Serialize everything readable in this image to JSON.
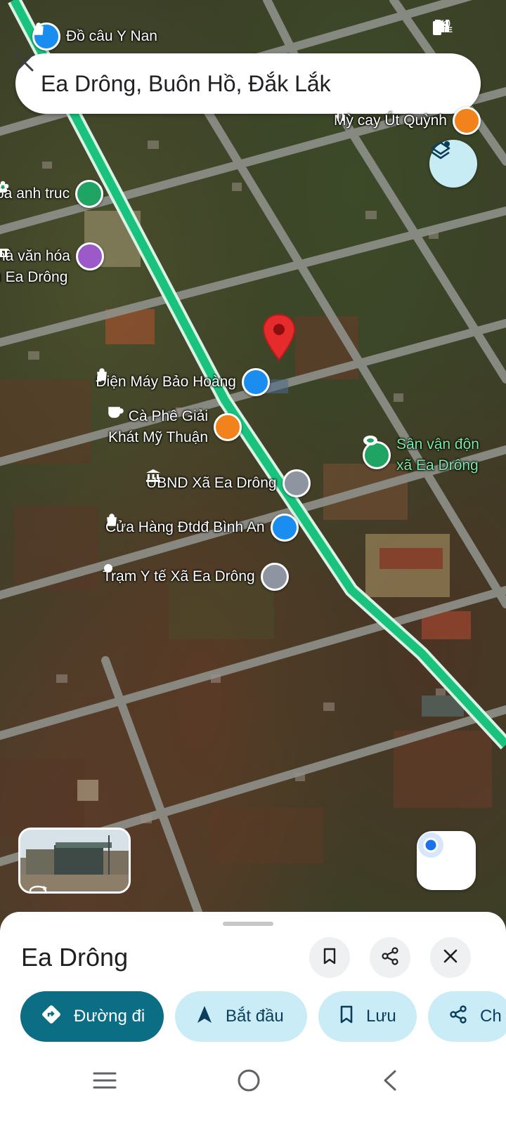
{
  "search": {
    "query": "Ea Drông, Buôn Hồ, Đắk Lắk"
  },
  "pois": {
    "do_cau": "Đồ câu Y Nan",
    "my_cay": "Mỳ cay Út Quỳnh",
    "anh_truc": "pa anh truc",
    "nha_van_hoa_1": "hà văn hóa",
    "nha_van_hoa_2": "ı Ea Drông",
    "dien_may": "Điện Máy Bảo Hoàng",
    "ca_phe_1": "Cà Phê Giải",
    "ca_phe_2": "Khát Mỹ Thuận",
    "san_van_dong_1": "Sân vận độn",
    "san_van_dong_2": "xã Ea Drông",
    "ubnd": "UBND Xã Ea Drông",
    "cua_hang": "Cửa Hàng Đtdđ Bình An",
    "tram_y_te": "Trạm Y tế Xã Ea Drông"
  },
  "place": {
    "title": "Ea Drông"
  },
  "actions": [
    {
      "label": "Đường đi"
    },
    {
      "label": "Bắt đầu"
    },
    {
      "label": "Lưu"
    },
    {
      "label": "Ch"
    }
  ],
  "colors": {
    "accent": "#0b6e84",
    "chip": "#c9ecf6",
    "route": "#19c37d",
    "marker": "#e52b2b",
    "shopping_pin": "#1a8df0",
    "food_pin": "#f2821c",
    "civic_pin": "#8e95a0",
    "culture_pin": "#9b59c9",
    "park_pin": "#1fa463"
  },
  "icons": {
    "close": "close-icon",
    "layers": "layers-icon",
    "location": "my-location-icon",
    "bookmark": "bookmark-icon",
    "share": "share-icon",
    "directions": "directions-icon",
    "navigate": "navigation-arrow-icon"
  }
}
